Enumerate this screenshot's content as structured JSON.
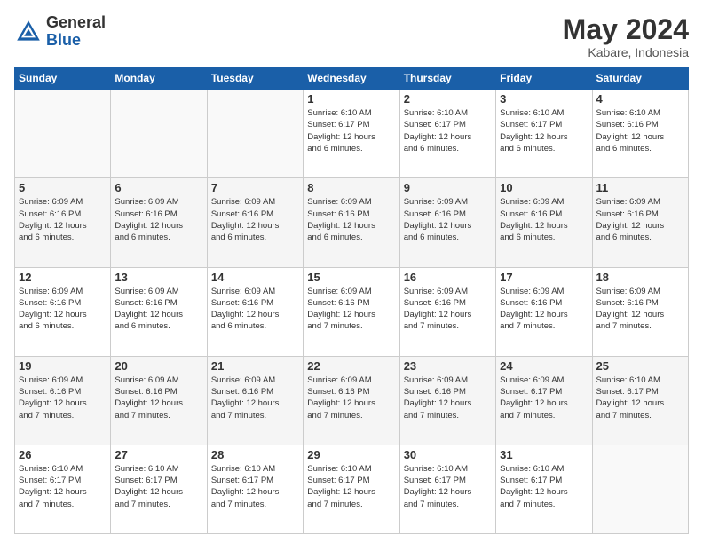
{
  "logo": {
    "general": "General",
    "blue": "Blue"
  },
  "header": {
    "month": "May 2024",
    "location": "Kabare, Indonesia"
  },
  "weekdays": [
    "Sunday",
    "Monday",
    "Tuesday",
    "Wednesday",
    "Thursday",
    "Friday",
    "Saturday"
  ],
  "weeks": [
    [
      {
        "day": "",
        "info": ""
      },
      {
        "day": "",
        "info": ""
      },
      {
        "day": "",
        "info": ""
      },
      {
        "day": "1",
        "info": "Sunrise: 6:10 AM\nSunset: 6:17 PM\nDaylight: 12 hours\nand 6 minutes."
      },
      {
        "day": "2",
        "info": "Sunrise: 6:10 AM\nSunset: 6:17 PM\nDaylight: 12 hours\nand 6 minutes."
      },
      {
        "day": "3",
        "info": "Sunrise: 6:10 AM\nSunset: 6:17 PM\nDaylight: 12 hours\nand 6 minutes."
      },
      {
        "day": "4",
        "info": "Sunrise: 6:10 AM\nSunset: 6:16 PM\nDaylight: 12 hours\nand 6 minutes."
      }
    ],
    [
      {
        "day": "5",
        "info": "Sunrise: 6:09 AM\nSunset: 6:16 PM\nDaylight: 12 hours\nand 6 minutes."
      },
      {
        "day": "6",
        "info": "Sunrise: 6:09 AM\nSunset: 6:16 PM\nDaylight: 12 hours\nand 6 minutes."
      },
      {
        "day": "7",
        "info": "Sunrise: 6:09 AM\nSunset: 6:16 PM\nDaylight: 12 hours\nand 6 minutes."
      },
      {
        "day": "8",
        "info": "Sunrise: 6:09 AM\nSunset: 6:16 PM\nDaylight: 12 hours\nand 6 minutes."
      },
      {
        "day": "9",
        "info": "Sunrise: 6:09 AM\nSunset: 6:16 PM\nDaylight: 12 hours\nand 6 minutes."
      },
      {
        "day": "10",
        "info": "Sunrise: 6:09 AM\nSunset: 6:16 PM\nDaylight: 12 hours\nand 6 minutes."
      },
      {
        "day": "11",
        "info": "Sunrise: 6:09 AM\nSunset: 6:16 PM\nDaylight: 12 hours\nand 6 minutes."
      }
    ],
    [
      {
        "day": "12",
        "info": "Sunrise: 6:09 AM\nSunset: 6:16 PM\nDaylight: 12 hours\nand 6 minutes."
      },
      {
        "day": "13",
        "info": "Sunrise: 6:09 AM\nSunset: 6:16 PM\nDaylight: 12 hours\nand 6 minutes."
      },
      {
        "day": "14",
        "info": "Sunrise: 6:09 AM\nSunset: 6:16 PM\nDaylight: 12 hours\nand 6 minutes."
      },
      {
        "day": "15",
        "info": "Sunrise: 6:09 AM\nSunset: 6:16 PM\nDaylight: 12 hours\nand 7 minutes."
      },
      {
        "day": "16",
        "info": "Sunrise: 6:09 AM\nSunset: 6:16 PM\nDaylight: 12 hours\nand 7 minutes."
      },
      {
        "day": "17",
        "info": "Sunrise: 6:09 AM\nSunset: 6:16 PM\nDaylight: 12 hours\nand 7 minutes."
      },
      {
        "day": "18",
        "info": "Sunrise: 6:09 AM\nSunset: 6:16 PM\nDaylight: 12 hours\nand 7 minutes."
      }
    ],
    [
      {
        "day": "19",
        "info": "Sunrise: 6:09 AM\nSunset: 6:16 PM\nDaylight: 12 hours\nand 7 minutes."
      },
      {
        "day": "20",
        "info": "Sunrise: 6:09 AM\nSunset: 6:16 PM\nDaylight: 12 hours\nand 7 minutes."
      },
      {
        "day": "21",
        "info": "Sunrise: 6:09 AM\nSunset: 6:16 PM\nDaylight: 12 hours\nand 7 minutes."
      },
      {
        "day": "22",
        "info": "Sunrise: 6:09 AM\nSunset: 6:16 PM\nDaylight: 12 hours\nand 7 minutes."
      },
      {
        "day": "23",
        "info": "Sunrise: 6:09 AM\nSunset: 6:16 PM\nDaylight: 12 hours\nand 7 minutes."
      },
      {
        "day": "24",
        "info": "Sunrise: 6:09 AM\nSunset: 6:17 PM\nDaylight: 12 hours\nand 7 minutes."
      },
      {
        "day": "25",
        "info": "Sunrise: 6:10 AM\nSunset: 6:17 PM\nDaylight: 12 hours\nand 7 minutes."
      }
    ],
    [
      {
        "day": "26",
        "info": "Sunrise: 6:10 AM\nSunset: 6:17 PM\nDaylight: 12 hours\nand 7 minutes."
      },
      {
        "day": "27",
        "info": "Sunrise: 6:10 AM\nSunset: 6:17 PM\nDaylight: 12 hours\nand 7 minutes."
      },
      {
        "day": "28",
        "info": "Sunrise: 6:10 AM\nSunset: 6:17 PM\nDaylight: 12 hours\nand 7 minutes."
      },
      {
        "day": "29",
        "info": "Sunrise: 6:10 AM\nSunset: 6:17 PM\nDaylight: 12 hours\nand 7 minutes."
      },
      {
        "day": "30",
        "info": "Sunrise: 6:10 AM\nSunset: 6:17 PM\nDaylight: 12 hours\nand 7 minutes."
      },
      {
        "day": "31",
        "info": "Sunrise: 6:10 AM\nSunset: 6:17 PM\nDaylight: 12 hours\nand 7 minutes."
      },
      {
        "day": "",
        "info": ""
      }
    ]
  ]
}
